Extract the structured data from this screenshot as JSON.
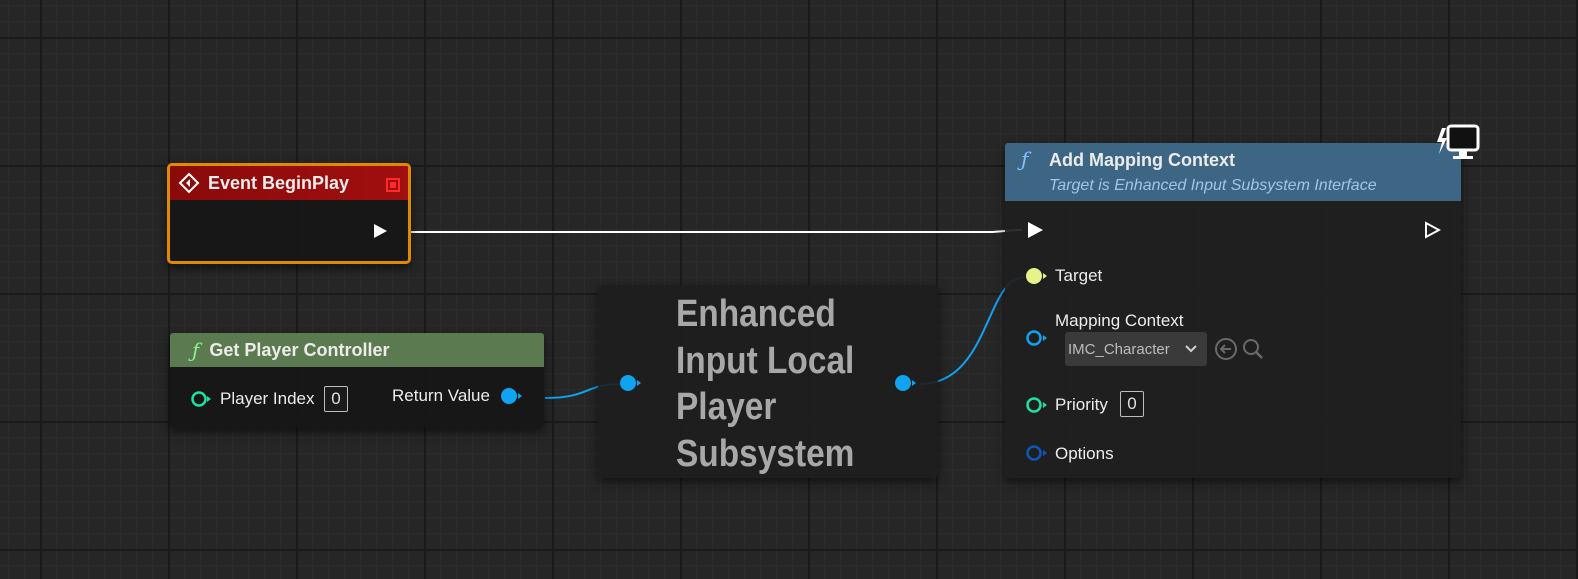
{
  "nodes": {
    "event_beginplay": {
      "title": "Event BeginPlay"
    },
    "get_player_controller": {
      "title": "Get Player Controller",
      "function_icon": "ƒ",
      "inputs": [
        {
          "label": "Player Index",
          "value": "0"
        }
      ],
      "outputs": [
        {
          "label": "Return Value"
        }
      ]
    },
    "enhanced_subsystem": {
      "title_lines": [
        "Enhanced",
        "Input Local",
        "Player",
        "Subsystem"
      ]
    },
    "add_mapping_context": {
      "title": "Add Mapping Context",
      "subtitle": "Target is Enhanced Input Subsystem Interface",
      "function_icon": "ƒ",
      "inputs": [
        {
          "label": "Target"
        },
        {
          "label": "Mapping Context",
          "value": "IMC_Character"
        },
        {
          "label": "Priority",
          "value": "0"
        },
        {
          "label": "Options"
        }
      ]
    }
  },
  "colors": {
    "event_header": "#8a0a0a",
    "event_border": "#e08a00",
    "function_header_green": "#5c7a4f",
    "function_header_blue": "#3d6584",
    "pin_int": "#1fe0a0",
    "pin_object": "#0fa3f0",
    "pin_target": "#e6f28a",
    "pin_struct": "#0b58b8",
    "exec_wire": "#ffffff"
  },
  "icons": {
    "event": "event-diamond-icon",
    "breakpoint": "red-square-icon",
    "function": "function-f-icon",
    "server_client": "lightning-monitor-icon",
    "browse": "browse-arrow-icon",
    "find": "magnifier-icon",
    "dropdown": "chevron-down-icon"
  }
}
